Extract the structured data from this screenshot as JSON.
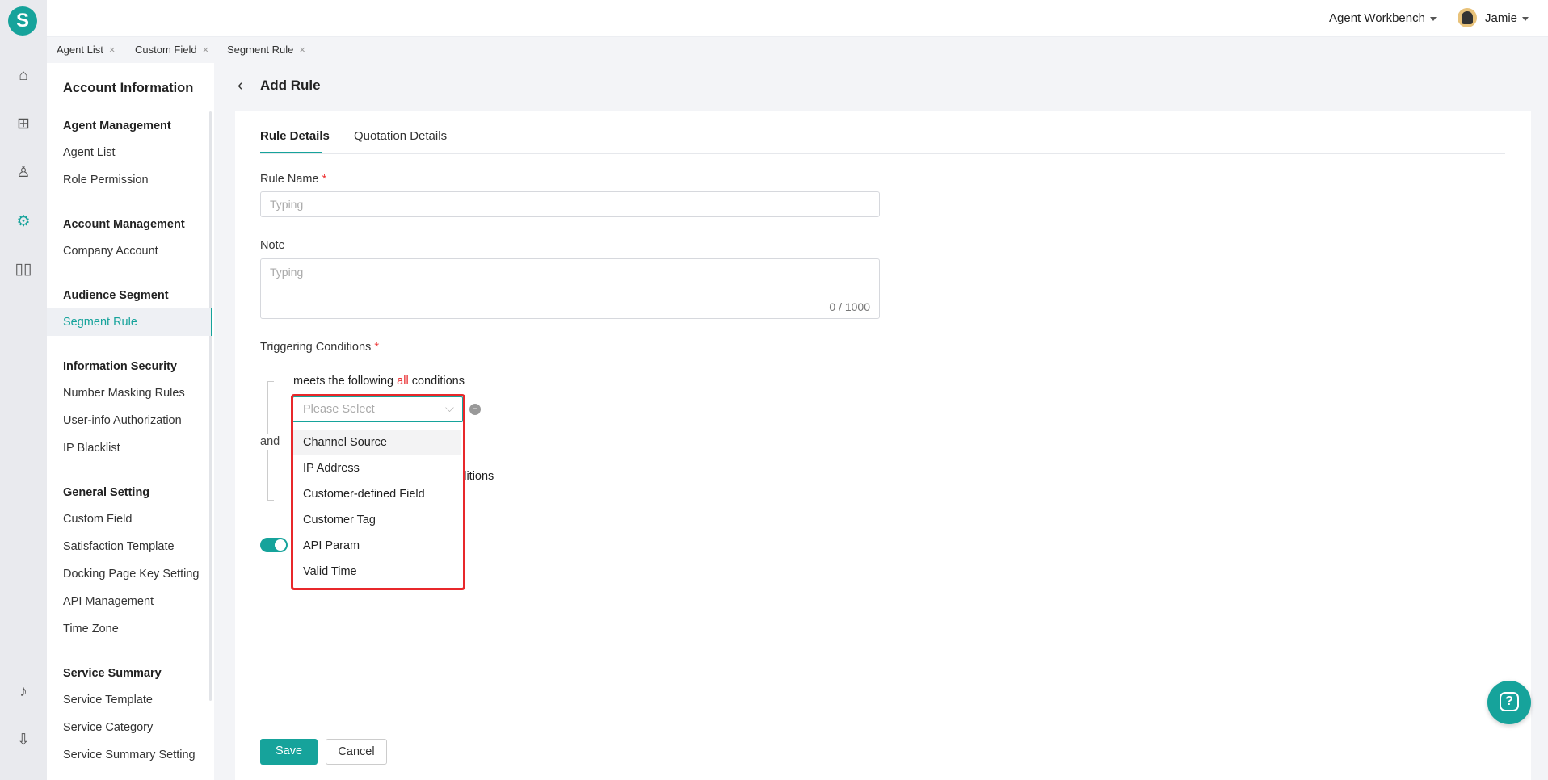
{
  "app": {
    "logo_letter": "S"
  },
  "rail": {
    "icons": [
      "home-icon",
      "apps-icon",
      "user-icon",
      "settings-icon",
      "book-icon",
      "bell-icon",
      "download-icon"
    ]
  },
  "topbar": {
    "workbench": "Agent Workbench",
    "user": "Jamie"
  },
  "tabs": [
    {
      "label": "Agent List"
    },
    {
      "label": "Custom Field"
    },
    {
      "label": "Segment Rule"
    }
  ],
  "tab_close": "×",
  "sidebar": {
    "title": "Account Information",
    "groups": [
      {
        "heading": "Agent Management",
        "items": [
          "Agent List",
          "Role Permission"
        ]
      },
      {
        "heading": "Account Management",
        "items": [
          "Company Account"
        ]
      },
      {
        "heading": "Audience Segment",
        "items": [
          "Segment Rule"
        ]
      },
      {
        "heading": "Information Security",
        "items": [
          "Number Masking Rules",
          "User-info Authorization",
          "IP Blacklist"
        ]
      },
      {
        "heading": "General Setting",
        "items": [
          "Custom Field",
          "Satisfaction Template",
          "Docking Page Key Setting",
          "API Management",
          "Time Zone"
        ]
      },
      {
        "heading": "Service Summary",
        "items": [
          "Service Template",
          "Service Category",
          "Service Summary Setting"
        ]
      }
    ],
    "active": "Segment Rule"
  },
  "page": {
    "title": "Add Rule",
    "back": "‹"
  },
  "form_tabs": {
    "active": "Rule Details",
    "other": "Quotation Details"
  },
  "form": {
    "rule_name_label": "Rule Name",
    "required": "*",
    "rule_name_placeholder": "Typing",
    "note_label": "Note",
    "note_placeholder": "Typing",
    "note_count": "0 / 1000",
    "conditions_label": "Triggering Conditions",
    "and": "and",
    "group1_pre": "meets the following",
    "group1_em": "all",
    "group1_post": "conditions",
    "group2_tail": "conditions",
    "select_placeholder": "Please Select",
    "options": [
      "Channel Source",
      "IP Address",
      "Customer-defined Field",
      "Customer Tag",
      "API Param",
      "Valid Time"
    ],
    "highlighted_option": "Channel Source",
    "toggle_on": true
  },
  "footer": {
    "save": "Save",
    "cancel": "Cancel"
  },
  "help": {
    "label": "?"
  },
  "colors": {
    "accent": "#16a39b",
    "highlight": "#e8282b"
  }
}
